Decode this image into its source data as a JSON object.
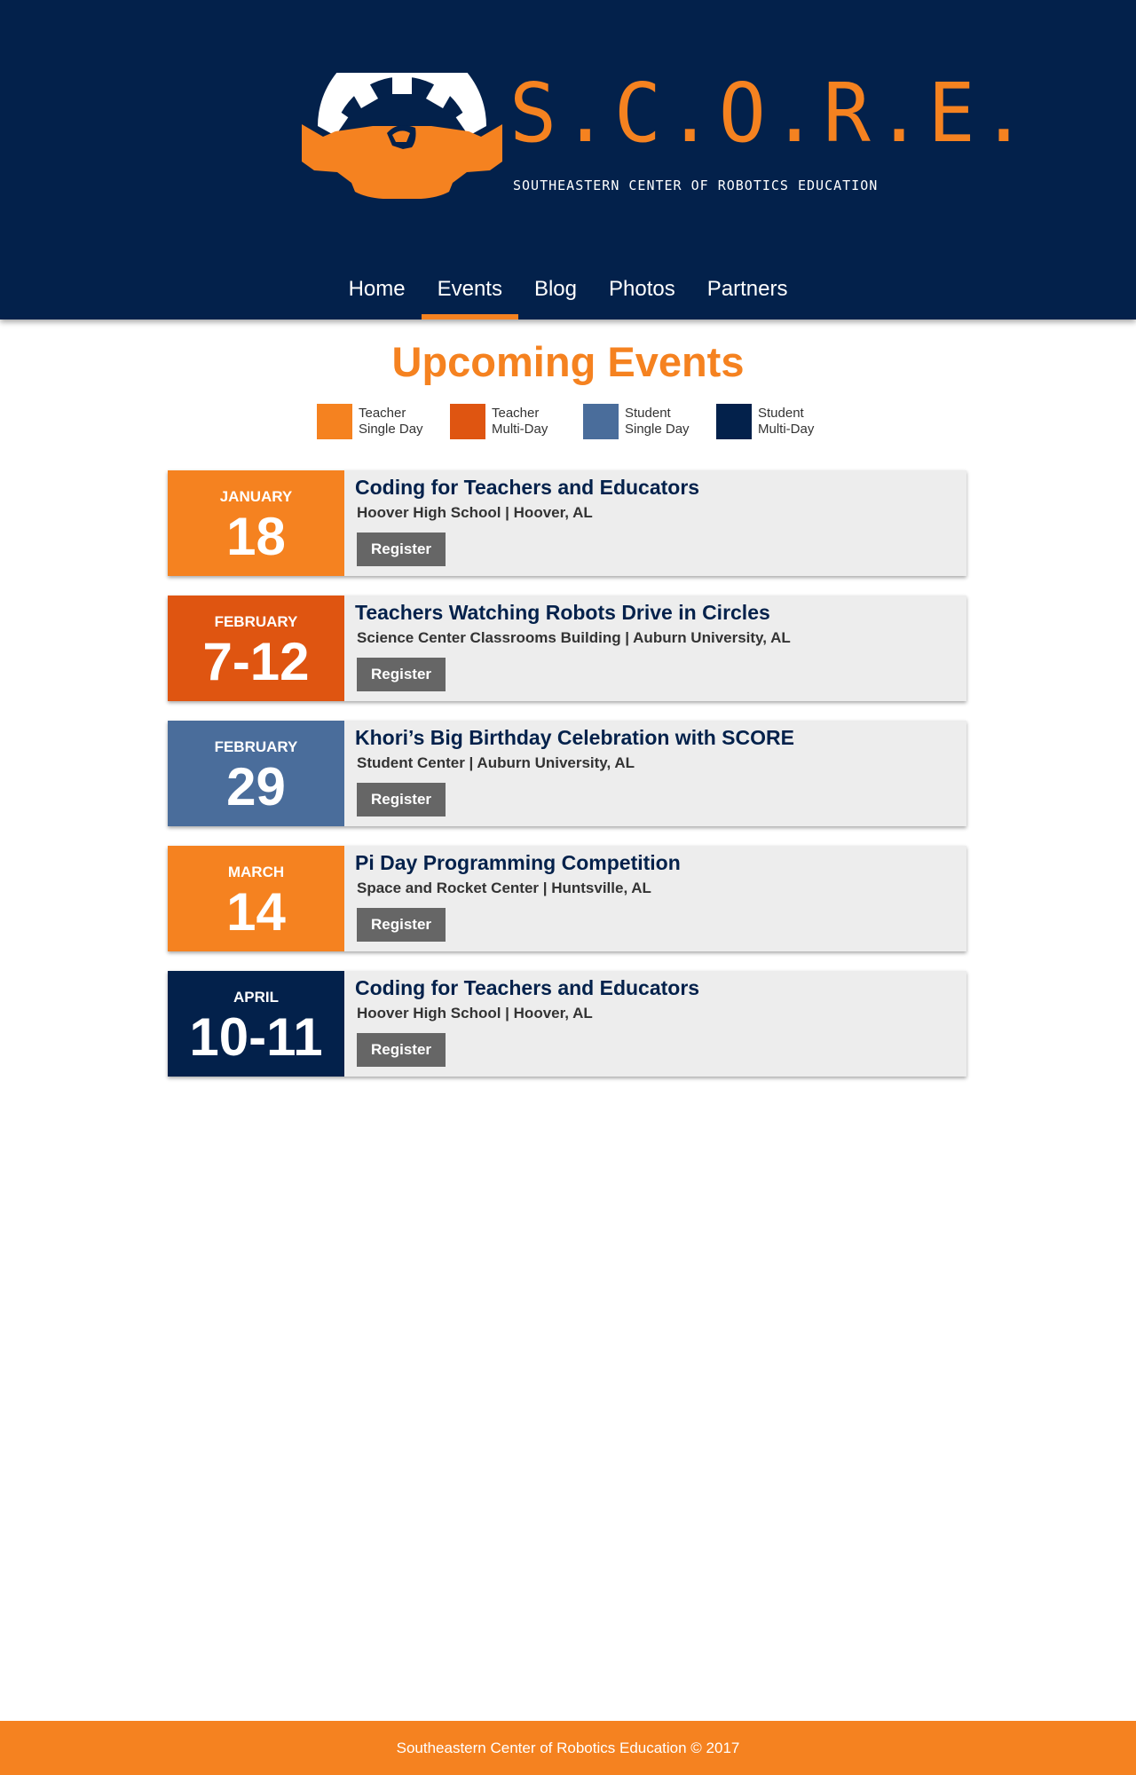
{
  "brand": {
    "title": "S.C.O.R.E.",
    "subtitle": "SOUTHEASTERN CENTER OF ROBOTICS EDUCATION"
  },
  "nav": {
    "items": [
      {
        "label": "Home",
        "active": false
      },
      {
        "label": "Events",
        "active": true
      },
      {
        "label": "Blog",
        "active": false
      },
      {
        "label": "Photos",
        "active": false
      },
      {
        "label": "Partners",
        "active": false
      }
    ]
  },
  "page": {
    "title": "Upcoming Events"
  },
  "legend": [
    {
      "line1": "Teacher",
      "line2": "Single Day",
      "color": "#f58220"
    },
    {
      "line1": "Teacher",
      "line2": "Multi-Day",
      "color": "#df5511"
    },
    {
      "line1": "Student",
      "line2": "Single Day",
      "color": "#4a6d9b"
    },
    {
      "line1": "Student",
      "line2": "Multi-Day",
      "color": "#03214b"
    }
  ],
  "events": [
    {
      "month": "JANUARY",
      "day": "18",
      "title": "Coding for Teachers and Educators",
      "location": "Hoover High School | Hoover, AL",
      "button": "Register",
      "color": "#f58220"
    },
    {
      "month": "FEBRUARY",
      "day": "7-12",
      "title": "Teachers Watching Robots Drive in Circles",
      "location": "Science Center Classrooms Building | Auburn University, AL",
      "button": "Register",
      "color": "#df5511"
    },
    {
      "month": "FEBRUARY",
      "day": "29",
      "title": "Khori’s Big Birthday Celebration with SCORE",
      "location": "Student Center | Auburn University, AL",
      "button": "Register",
      "color": "#4a6d9b"
    },
    {
      "month": "MARCH",
      "day": "14",
      "title": "Pi Day Programming Competition",
      "location": "Space and Rocket Center | Huntsville, AL",
      "button": "Register",
      "color": "#f58220"
    },
    {
      "month": "APRIL",
      "day": "10-11",
      "title": "Coding for Teachers and Educators",
      "location": "Hoover High School | Hoover, AL",
      "button": "Register",
      "color": "#03214b"
    }
  ],
  "footer": {
    "text": "Southeastern Center of Robotics Education © 2017"
  },
  "colors": {
    "header_bg": "#03214b",
    "accent_orange": "#f58220",
    "button_gray": "#666666",
    "card_bg": "#ededed"
  }
}
